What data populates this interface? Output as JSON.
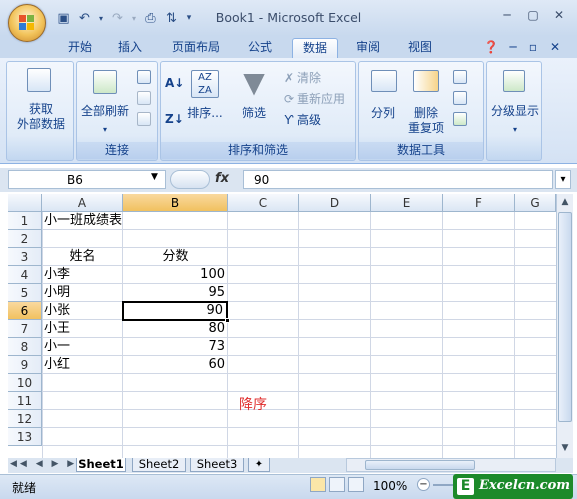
{
  "window_title": "Book1 - Microsoft Excel",
  "tabs": [
    "开始",
    "插入",
    "页面布局",
    "公式",
    "数据",
    "审阅",
    "视图"
  ],
  "ribbon": {
    "get_external": "获取\n外部数据",
    "refresh_all": "全部刷新",
    "group_connect": "连接",
    "sort": "排序...",
    "filter": "筛选",
    "clear": "清除",
    "reapply": "重新应用",
    "advanced": "高级",
    "group_sort_filter": "排序和筛选",
    "text_to_cols": "分列",
    "remove_dup": "删除\n重复项",
    "group_data_tools": "数据工具",
    "outline": "分级显示"
  },
  "name_box": "B6",
  "formula_value": "90",
  "columns": [
    "A",
    "B",
    "C",
    "D",
    "E",
    "F",
    "G"
  ],
  "rows": [
    "1",
    "2",
    "3",
    "4",
    "5",
    "6",
    "7",
    "8",
    "9",
    "10",
    "11",
    "12",
    "13"
  ],
  "cells": {
    "A1": "小一班成绩表",
    "A3": "姓名",
    "B3": "分数",
    "A4": "小李",
    "B4": "100",
    "A5": "小明",
    "B5": "95",
    "A6": "小张",
    "B6": "90",
    "A7": "小王",
    "B7": "80",
    "A8": "小一",
    "B8": "73",
    "A9": "小红",
    "B9": "60",
    "C11": "降序"
  },
  "sheets": [
    "Sheet1",
    "Sheet2",
    "Sheet3"
  ],
  "status_text": "就绪",
  "zoom": "100%",
  "watermark": "Excelcn.com",
  "colors": {
    "accent": "#15428b",
    "selection": "#f1c15f",
    "annotation": "#e03030"
  }
}
